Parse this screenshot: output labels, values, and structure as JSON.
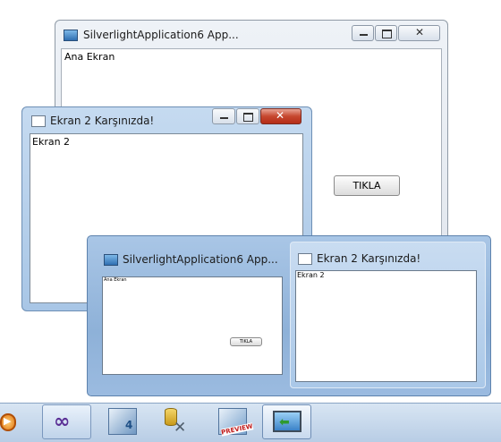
{
  "main_window": {
    "title": "SilverlightApplication6 App...",
    "content_label": "Ana Ekran",
    "button_label": "TIKLA"
  },
  "second_window": {
    "title": "Ekran 2 Karşınızda!",
    "content_label": "Ekran 2"
  },
  "preview": {
    "item1_title": "SilverlightApplication6 App...",
    "item1_label": "Ana Ekran",
    "item1_button": "TIKLA",
    "item2_title": "Ekran 2 Karşınızda!",
    "item2_label": "Ekran 2"
  },
  "taskbar": {
    "icons": [
      "media-player-icon",
      "visual-studio-icon",
      "silverlight-icon",
      "database-tools-icon",
      "preview-icon",
      "silverlight-app-icon"
    ],
    "preview_badge": "PREVIEW"
  }
}
